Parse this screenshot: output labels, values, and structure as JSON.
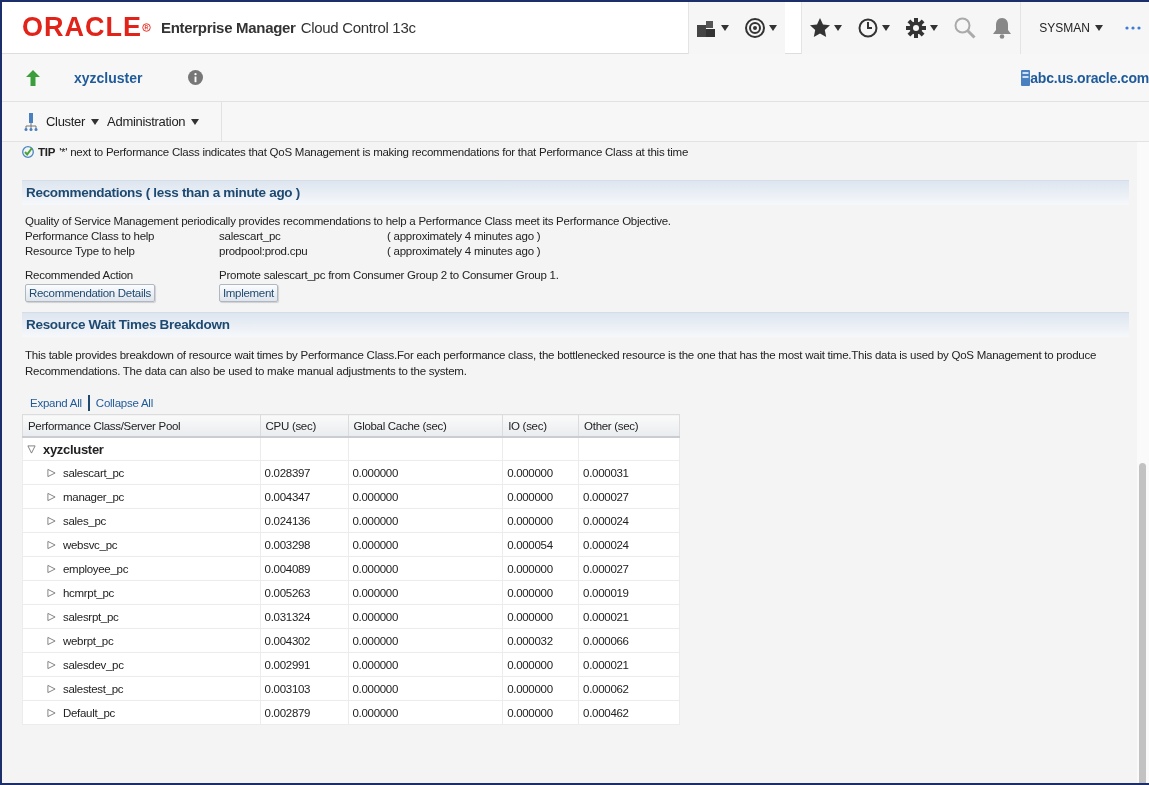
{
  "header": {
    "logo": "ORACLE",
    "product": "Enterprise Manager",
    "edition": "Cloud Control 13c",
    "user": "SYSMAN"
  },
  "target": {
    "name": "xyzcluster",
    "host": "abc.us.oracle.com"
  },
  "menus": [
    "Cluster",
    "Administration"
  ],
  "tip": {
    "label": "TIP",
    "text": "'*' next to Performance Class indicates that QoS Management is making recommendations for that Performance Class at this time"
  },
  "recommendations": {
    "title": "Recommendations ( less than a minute ago )",
    "intro": "Quality of Service Management periodically provides recommendations to help a Performance Class meet its Performance Objective.",
    "fields": [
      {
        "label": "Performance Class to help",
        "value": "salescart_pc",
        "time": "( approximately 4 minutes ago )"
      },
      {
        "label": "Resource Type to help",
        "value": "prodpool:prod.cpu",
        "time": "( approximately 4 minutes ago )"
      }
    ],
    "action": {
      "label": "Recommended Action",
      "value": "Promote salescart_pc from Consumer Group 2 to Consumer Group 1."
    },
    "buttons": [
      "Recommendation Details",
      "Implement"
    ]
  },
  "breakdown": {
    "title": "Resource Wait Times Breakdown",
    "description": "This table provides breakdown of resource wait times by Performance Class.For each performance class, the bottlenecked resource is the one that has the most wait time.This data is used by QoS Management to produce Recommendations. The data can also be used to make manual adjustments to the system.",
    "links": [
      "Expand All",
      "Collapse All"
    ],
    "columns": [
      "Performance Class/Server Pool",
      "CPU (sec)",
      "Global Cache (sec)",
      "IO (sec)",
      "Other (sec)"
    ],
    "tree": {
      "name": "xyzcluster",
      "expanded": true,
      "children": [
        {
          "name": "salescart_pc",
          "expanded": false,
          "values": [
            "0.028397",
            "0.000000",
            "0.000000",
            "0.000031"
          ]
        },
        {
          "name": "manager_pc",
          "expanded": false,
          "values": [
            "0.004347",
            "0.000000",
            "0.000000",
            "0.000027"
          ]
        },
        {
          "name": "sales_pc",
          "expanded": false,
          "values": [
            "0.024136",
            "0.000000",
            "0.000000",
            "0.000024"
          ]
        },
        {
          "name": "websvc_pc",
          "expanded": false,
          "values": [
            "0.003298",
            "0.000000",
            "0.000054",
            "0.000024"
          ]
        },
        {
          "name": "employee_pc",
          "expanded": false,
          "values": [
            "0.004089",
            "0.000000",
            "0.000000",
            "0.000027"
          ]
        },
        {
          "name": "hcmrpt_pc",
          "expanded": false,
          "values": [
            "0.005263",
            "0.000000",
            "0.000000",
            "0.000019"
          ]
        },
        {
          "name": "salesrpt_pc",
          "expanded": false,
          "values": [
            "0.031324",
            "0.000000",
            "0.000000",
            "0.000021"
          ]
        },
        {
          "name": "webrpt_pc",
          "expanded": false,
          "values": [
            "0.004302",
            "0.000000",
            "0.000032",
            "0.000066"
          ]
        },
        {
          "name": "salesdev_pc",
          "expanded": false,
          "values": [
            "0.002991",
            "0.000000",
            "0.000000",
            "0.000021"
          ]
        },
        {
          "name": "salestest_pc",
          "expanded": false,
          "values": [
            "0.003103",
            "0.000000",
            "0.000000",
            "0.000062"
          ]
        },
        {
          "name": "Default_pc",
          "expanded": false,
          "values": [
            "0.002879",
            "0.000000",
            "0.000000",
            "0.000462"
          ]
        }
      ]
    }
  }
}
